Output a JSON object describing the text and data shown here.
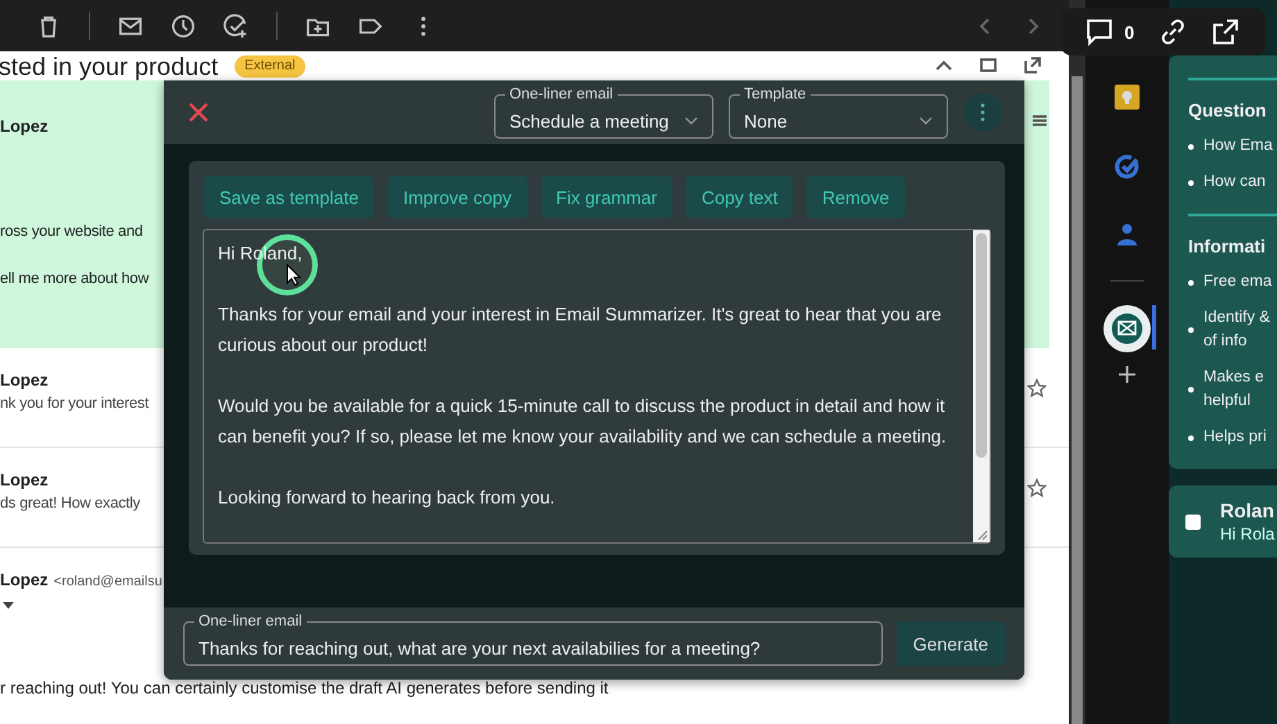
{
  "mail": {
    "subject": "sted in your product",
    "badge": "External",
    "messages": [
      {
        "highlighted": true,
        "sender": "Lopez",
        "lines": [
          "ross your website and",
          "ell me more about how"
        ]
      },
      {
        "highlighted": false,
        "starred": false,
        "sender": "Lopez",
        "lines": [
          "nk you for your interest"
        ]
      },
      {
        "highlighted": false,
        "starred": false,
        "sender": "Lopez",
        "lines": [
          "ds great! How exactly"
        ]
      }
    ],
    "open_message": {
      "sender": "Lopez",
      "address": "<roland@emailsu",
      "body": "r reaching out! You can certainly customise the draft AI generates before sending it"
    }
  },
  "modal": {
    "selects": [
      {
        "label": "One-liner email",
        "value": "Schedule a meeting"
      },
      {
        "label": "Template",
        "value": "None"
      }
    ],
    "actions": [
      "Save as template",
      "Improve copy",
      "Fix grammar",
      "Copy text",
      "Remove"
    ],
    "body": [
      "Hi Roland,",
      "Thanks for your email and your interest in Email Summarizer. It's great to hear that you are curious about our product!",
      "Would you be available for a quick 15-minute call to discuss the product in detail and how it can benefit you? If so, please let me know your availability and we can schedule a meeting.",
      "Looking forward to hearing back from you."
    ],
    "one_liner": {
      "label": "One-liner email",
      "value": "Thanks for reaching out, what are your next availabilies for a meeting?"
    },
    "generate": "Generate"
  },
  "rail": [
    {
      "kind": "keep",
      "selected": false
    },
    {
      "kind": "tasks",
      "selected": false
    },
    {
      "kind": "contacts",
      "selected": false
    },
    {
      "kind": "addon",
      "selected": true
    },
    {
      "kind": "add",
      "selected": false
    }
  ],
  "panel": {
    "sections": [
      {
        "heading": "Question",
        "items": [
          "How Ema",
          "How can"
        ]
      },
      {
        "heading": "Informati",
        "items": [
          "Free ema",
          "Identify &\nof info",
          "Makes e\nhelpful",
          "Helps pri"
        ]
      }
    ],
    "draft": {
      "checked": false,
      "title": "Rolan",
      "preview": "Hi Rola"
    }
  },
  "overlay": {
    "comment_count": "0"
  }
}
